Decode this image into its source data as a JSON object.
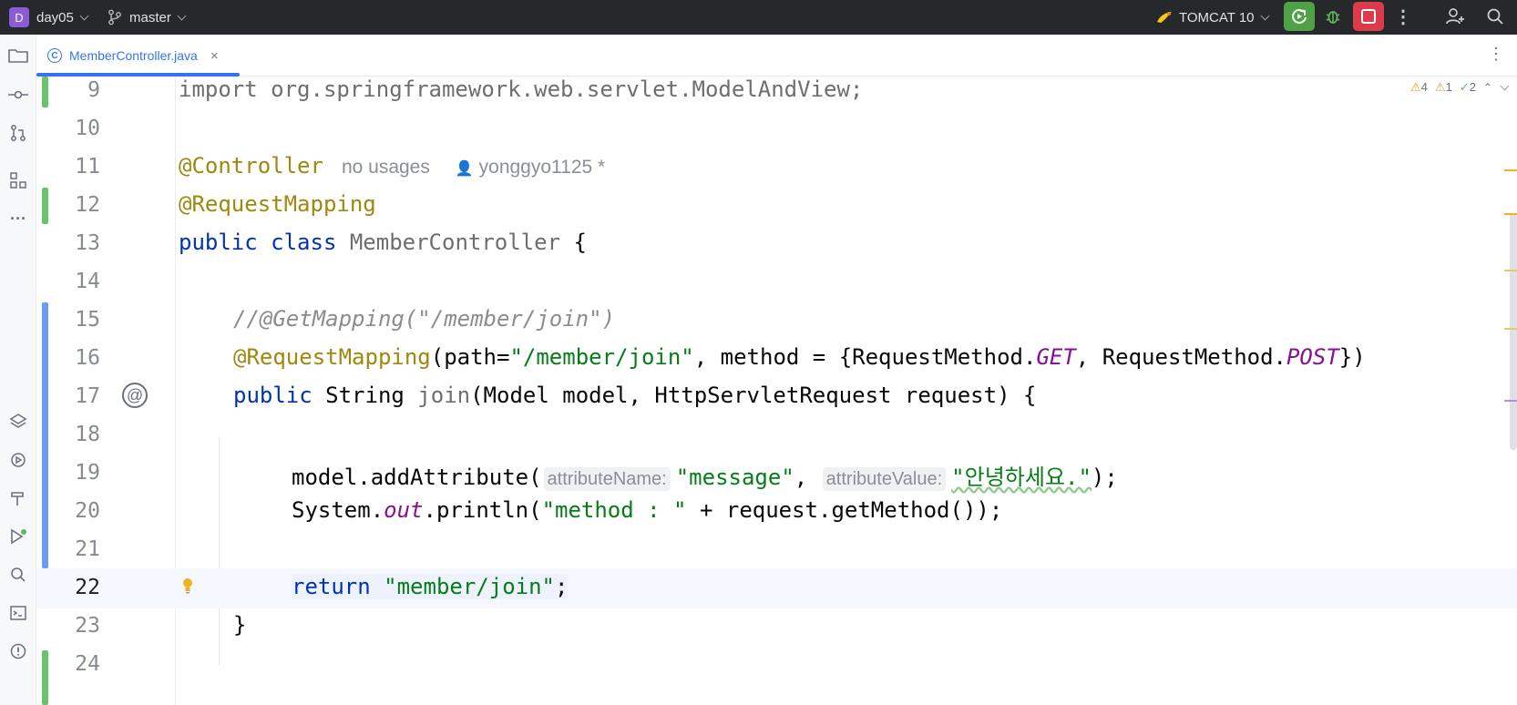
{
  "titlebar": {
    "project_badge": "D",
    "project_name": "day05",
    "branch": "master",
    "run_config": "TOMCAT 10"
  },
  "tab": {
    "file_icon_letter": "C",
    "file_name": "MemberController.java",
    "close_glyph": "×"
  },
  "inspections": {
    "warnings": "4",
    "weak_warnings": "1",
    "typos": "2"
  },
  "editor": {
    "caret_line": 22,
    "lines": [
      {
        "n": "9"
      },
      {
        "n": "10"
      },
      {
        "n": "11"
      },
      {
        "n": "12"
      },
      {
        "n": "13"
      },
      {
        "n": "14"
      },
      {
        "n": "15"
      },
      {
        "n": "16"
      },
      {
        "n": "17"
      },
      {
        "n": "18"
      },
      {
        "n": "19"
      },
      {
        "n": "20"
      },
      {
        "n": "21"
      },
      {
        "n": "22"
      },
      {
        "n": "23"
      },
      {
        "n": "24"
      }
    ],
    "code": {
      "l9": "import org.springframework.web.servlet.ModelAndView;",
      "l11_ann": "@Controller",
      "l11_usages": "no usages",
      "l11_author": "yonggyo1125 *",
      "l12_ann": "@RequestMapping",
      "l13_kw": "public class",
      "l13_name": "MemberController",
      "l13_brace": " {",
      "l15_comment": "//@GetMapping(\"/member/join\")",
      "l16_ann": "@RequestMapping",
      "l16_a": "(path=",
      "l16_path": "\"/member/join\"",
      "l16_b": ", method = {RequestMethod.",
      "l16_get": "GET",
      "l16_c": ", RequestMethod.",
      "l16_post": "POST",
      "l16_d": "})",
      "l17_kw": "public",
      "l17_type": " String ",
      "l17_name": "join",
      "l17_rest": "(Model model, HttpServletRequest request) {",
      "l19_a": "model.addAttribute(",
      "l19_hint1": "attributeName:",
      "l19_str1": "\"message\"",
      "l19_comma": ",",
      "l19_hint2": "attributeValue:",
      "l19_str2": "\"안녕하세요.\"",
      "l19_end": ");",
      "l20_a": "System.",
      "l20_out": "out",
      "l20_b": ".println(",
      "l20_str": "\"method : \"",
      "l20_c": " + request.getMethod());",
      "l22_kw": "return",
      "l22_str": "\"member/join\"",
      "l22_end": ";",
      "l23": "}"
    }
  },
  "icons": {
    "gutter_l17": "@",
    "bulb": "lightbulb-icon"
  },
  "colors": {
    "accent": "#3574f0",
    "vcs_added": "#6cc36e",
    "vcs_modified": "#6c9bef",
    "run_green": "#4fa145",
    "stop_red": "#db3b4b"
  }
}
